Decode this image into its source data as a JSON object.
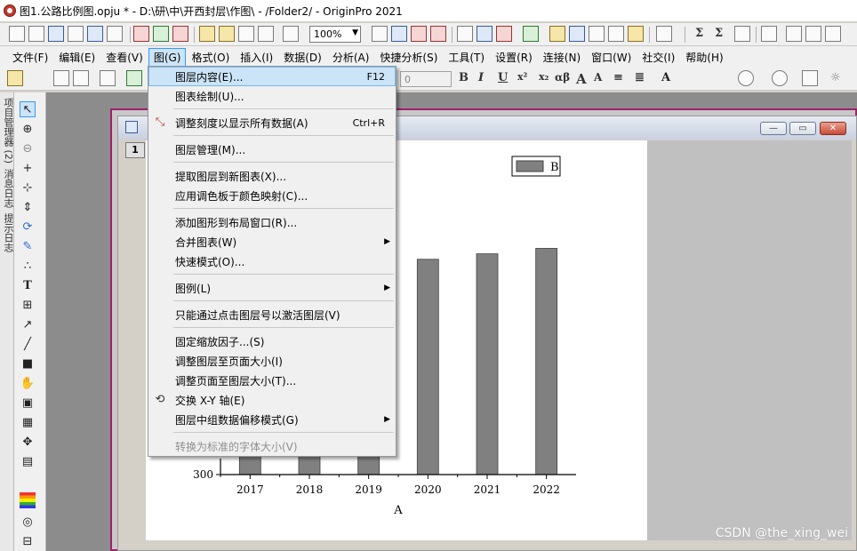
{
  "window": {
    "title": "图1.公路比例图.opju * - D:\\研\\中\\开西封层\\作图\\ - /Folder2/ - OriginPro 2021"
  },
  "toolbar": {
    "zoom": "100%",
    "font_size": "0",
    "bold": "B",
    "italic": "I",
    "underline": "U",
    "superscript": "x²",
    "subscript": "x₂",
    "greek": "αβ",
    "font_grow": "A",
    "font_shrink": "A"
  },
  "menubar": [
    "文件(F)",
    "编辑(E)",
    "查看(V)",
    "图(G)",
    "格式(O)",
    "插入(I)",
    "数据(D)",
    "分析(A)",
    "快捷分析(S)",
    "工具(T)",
    "设置(R)",
    "连接(N)",
    "窗口(W)",
    "社交(I)",
    "帮助(H)"
  ],
  "menubar_active": 3,
  "left_dock": [
    "项目管理器 (2)",
    "消息日志",
    "提示日志"
  ],
  "graph_window": {
    "layer_button": "1",
    "buttons": {
      "minimize": "—",
      "restore": "▭",
      "close": "✕"
    }
  },
  "dropdown": [
    {
      "label": "图层内容(E)...",
      "shortcut": "F12",
      "highlighted": true
    },
    {
      "label": "图表绘制(U)..."
    },
    {
      "sep": true
    },
    {
      "label": "调整刻度以显示所有数据(A)",
      "shortcut": "Ctrl+R",
      "icon": "rescale-icon"
    },
    {
      "sep": true
    },
    {
      "label": "图层管理(M)..."
    },
    {
      "sep": true
    },
    {
      "label": "提取图层到新图表(X)..."
    },
    {
      "label": "应用调色板于颜色映射(C)..."
    },
    {
      "sep": true
    },
    {
      "label": "添加图形到布局窗口(R)..."
    },
    {
      "label": "合并图表(W)",
      "submenu": true
    },
    {
      "label": "快速模式(O)..."
    },
    {
      "sep": true
    },
    {
      "label": "图例(L)",
      "submenu": true
    },
    {
      "sep": true
    },
    {
      "label": "只能通过点击图层号以激活图层(V)"
    },
    {
      "sep": true
    },
    {
      "label": "固定缩放因子...(S)"
    },
    {
      "label": "调整图层至页面大小(I)"
    },
    {
      "label": "调整页面至图层大小(T)..."
    },
    {
      "label": "交换 X-Y 轴(E)",
      "icon": "swap-xy-icon"
    },
    {
      "label": "图层中组数据偏移模式(G)",
      "submenu": true
    },
    {
      "sep": true
    },
    {
      "label": "转换为标准的字体大小(V)",
      "disabled": true
    }
  ],
  "chart_data": {
    "type": "bar",
    "categories": [
      "2017",
      "2018",
      "2019",
      "2020",
      "2021",
      "2022"
    ],
    "series": [
      {
        "name": "B",
        "values": [
          null,
          null,
          null,
          1090,
          1110,
          1130
        ]
      }
    ],
    "xlabel": "A",
    "ylabel": "",
    "ylim": [
      300,
      null
    ],
    "visible_yticks": [
      300
    ],
    "colors": {
      "bar": "#808080",
      "bar_edge": "#404040"
    }
  },
  "watermark": "CSDN @the_xing_wei",
  "colors": {
    "menu_highlight": "#cce4f7",
    "window_border": "#a0206a",
    "workspace": "#8c8c8c"
  }
}
